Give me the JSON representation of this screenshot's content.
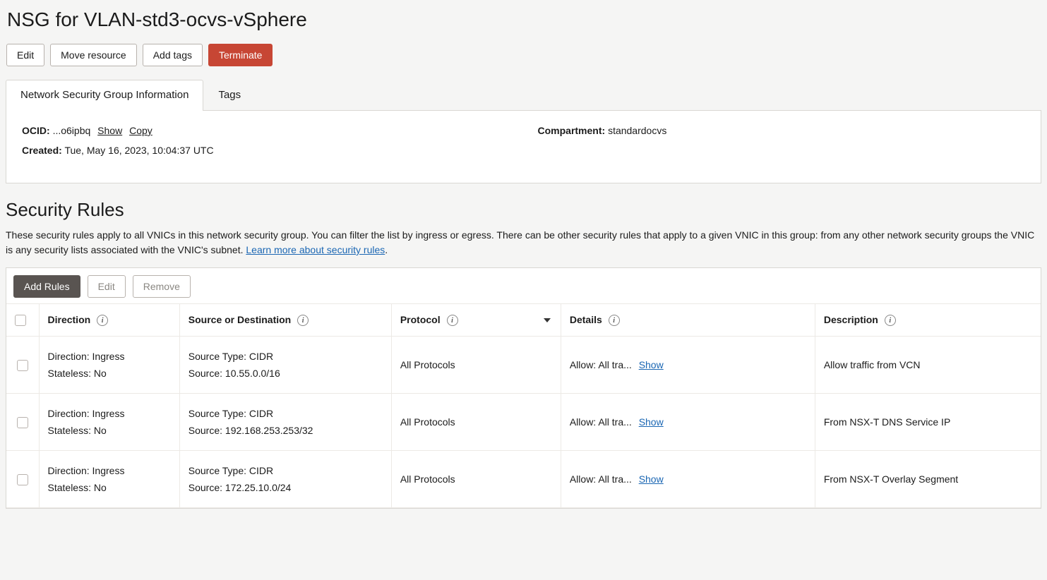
{
  "page": {
    "title": "NSG for VLAN-std3-ocvs-vSphere"
  },
  "actions": {
    "edit": "Edit",
    "move": "Move resource",
    "add_tags": "Add tags",
    "terminate": "Terminate"
  },
  "tabs": {
    "info": "Network Security Group Information",
    "tags": "Tags"
  },
  "info": {
    "ocid_label": "OCID:",
    "ocid_value": "...o6ipbq",
    "show": "Show",
    "copy": "Copy",
    "created_label": "Created:",
    "created_value": "Tue, May 16, 2023, 10:04:37 UTC",
    "compartment_label": "Compartment:",
    "compartment_value": "standardocvs"
  },
  "rules_section": {
    "title": "Security Rules",
    "desc_prefix": "These security rules apply to all VNICs in this network security group. You can filter the list by ingress or egress. There can be other security rules that apply to a given VNIC in this group: from any other network security groups the VNIC is any security lists associated with the VNIC's subnet. ",
    "learn_more": "Learn more about security rules",
    "add_rules": "Add Rules",
    "edit": "Edit",
    "remove": "Remove"
  },
  "columns": {
    "direction": "Direction",
    "source_dest": "Source or Destination",
    "protocol": "Protocol",
    "details": "Details",
    "description": "Description"
  },
  "field_labels": {
    "direction": "Direction:",
    "stateless": "Stateless:",
    "source_type": "Source Type:",
    "source": "Source:",
    "allow": "Allow:",
    "show": "Show"
  },
  "rows": [
    {
      "direction": "Ingress",
      "stateless": "No",
      "source_type": "CIDR",
      "source": "10.55.0.0/16",
      "protocol": "All Protocols",
      "details": "All tra...",
      "description": "Allow traffic from VCN"
    },
    {
      "direction": "Ingress",
      "stateless": "No",
      "source_type": "CIDR",
      "source": "192.168.253.253/32",
      "protocol": "All Protocols",
      "details": "All tra...",
      "description": "From NSX-T DNS Service IP"
    },
    {
      "direction": "Ingress",
      "stateless": "No",
      "source_type": "CIDR",
      "source": "172.25.10.0/24",
      "protocol": "All Protocols",
      "details": "All tra...",
      "description": "From NSX-T Overlay Segment"
    }
  ]
}
